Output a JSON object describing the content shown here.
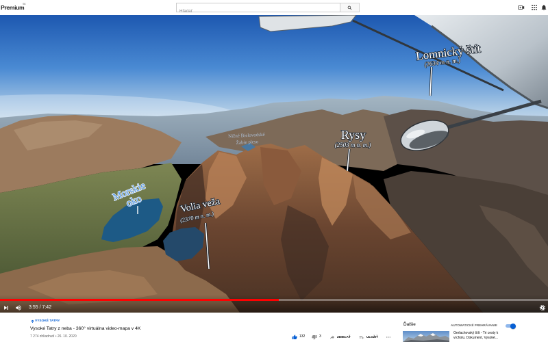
{
  "header": {
    "logo": "Premium",
    "region_badge": "SK",
    "search_placeholder": "Hľadať",
    "icons": {
      "search": "search-icon",
      "create": "video-camera-plus-icon",
      "apps": "apps-grid-icon",
      "notifications": "bell-icon"
    }
  },
  "video": {
    "labels": {
      "lomnicky": {
        "name": "Lomnický štít",
        "elevation": "(2634 m n. m.)"
      },
      "rysy": {
        "name": "Rysy",
        "elevation": "(2503 m n. m.)"
      },
      "morskie_oko": {
        "line1": "Morskie",
        "line2": "oko"
      },
      "volia_veza": {
        "name": "Volia veža",
        "elevation": "(2370 m n. m.)"
      },
      "bielovodske": {
        "line1": "Nižné Bielovodské",
        "line2": "Žabie pleso"
      }
    },
    "controls": {
      "time": "3:55 / 7:42",
      "progress": 0.509,
      "icons": [
        "next-icon",
        "volume-icon",
        "settings-gear-icon"
      ]
    }
  },
  "info": {
    "hashtag": "VYSOKÉ TATRY",
    "title": "Vysoké Tatry z neba - 360° virtuálna video-mapa v 4K",
    "stats": "7 274 zhliadnutí • 26. 10. 2020",
    "likes": "132",
    "dislikes": "3",
    "share": "ZDIEĽAŤ",
    "save": "ULOŽIŤ",
    "liked": true,
    "icons": [
      "location-pin-icon",
      "thumb-up-icon",
      "thumb-down-icon",
      "share-icon",
      "save-playlist-icon",
      "more-icon"
    ]
  },
  "sidebar": {
    "up_next": "Ďalšie",
    "autoplay": "AUTOMATICKÉ PREHRÁVANIE",
    "autoplay_on": true,
    "next_video_title": "Gerlachovský štít - Tri cesty k vrcholu. Dokument, Vysoké..."
  },
  "colors": {
    "accent": "#065fd4",
    "progress": "#ff0000",
    "liked_icon": "#065fd4",
    "icon_grey": "#909090"
  }
}
